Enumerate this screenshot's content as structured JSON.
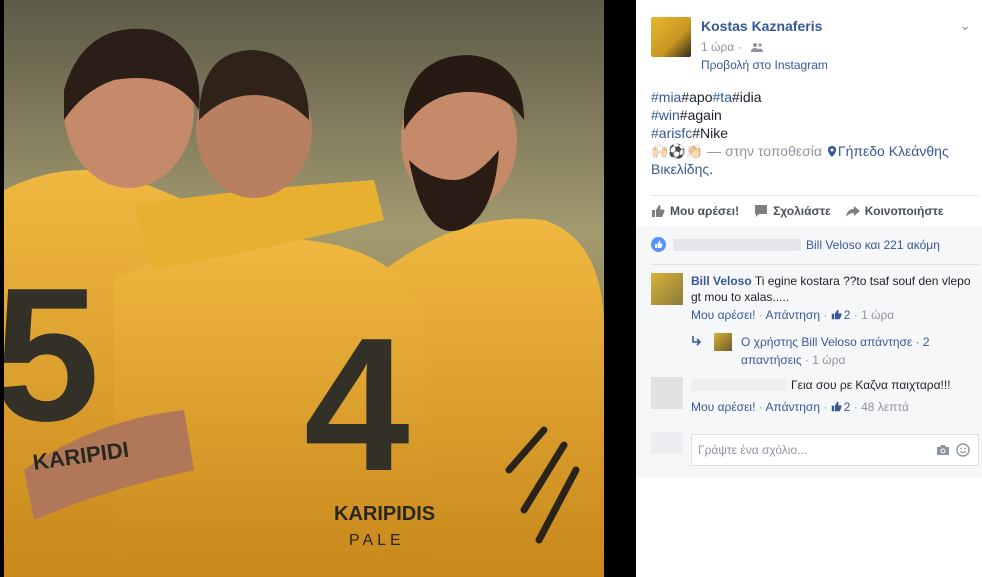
{
  "post": {
    "author": "Kostas Kaznaferis",
    "time": "1 ώρα",
    "via": "Προβολή στο Instagram",
    "text": {
      "line1": [
        {
          "t": "#mia",
          "tag": true
        },
        {
          "t": "#apo",
          "tag": false
        },
        {
          "t": "#ta",
          "tag": true
        },
        {
          "t": "#idia",
          "tag": false
        }
      ],
      "line2": [
        {
          "t": "#win",
          "tag": true
        },
        {
          "t": "#again",
          "tag": false
        }
      ],
      "line3": [
        {
          "t": "#arisfc",
          "tag": true
        },
        {
          "t": "#Nike",
          "tag": false
        }
      ],
      "emoji": "🙌🏻⚽👏🏻",
      "location_prefix": " — στην τοποθεσία ",
      "location": "Γήπεδο Κλεάνθης Βικελίδης",
      "location_suffix": "."
    }
  },
  "actions": {
    "like": "Μου αρέσει!",
    "comment": "Σχολιάστε",
    "share": "Κοινοποιήστε"
  },
  "likes": {
    "text": "Bill Veloso και 221 ακόμη"
  },
  "comments": [
    {
      "name": "Bill Veloso",
      "text": "Ti egine kostara ??to tsaf souf den vlepo gt mou to xalas.....",
      "like": "Μου αρέσει!",
      "reply": "Απάντηση",
      "count": "2",
      "time": "1 ώρα",
      "replies_link": "Ο χρήστης Bill Veloso απάντησε · 2 απαντήσεις",
      "replies_time": "1 ώρα"
    },
    {
      "name": "",
      "text": "Γεια σου ρε Καζνα παιχταρα!!!",
      "like": "Μου αρέσει!",
      "reply": "Απάντηση",
      "count": "2",
      "time": "48 λεπτά"
    }
  ],
  "comment_input": {
    "placeholder": "Γράψτε ένα σχόλιο..."
  },
  "photo": {
    "jersey_numbers": [
      "5",
      "4"
    ],
    "jersey_text": [
      "KARIPIDI",
      "KARIPIDIS",
      "PALE"
    ]
  },
  "colors": {
    "link": "#365899",
    "jersey": "#e8b030",
    "like_blue": "#5890ff"
  }
}
